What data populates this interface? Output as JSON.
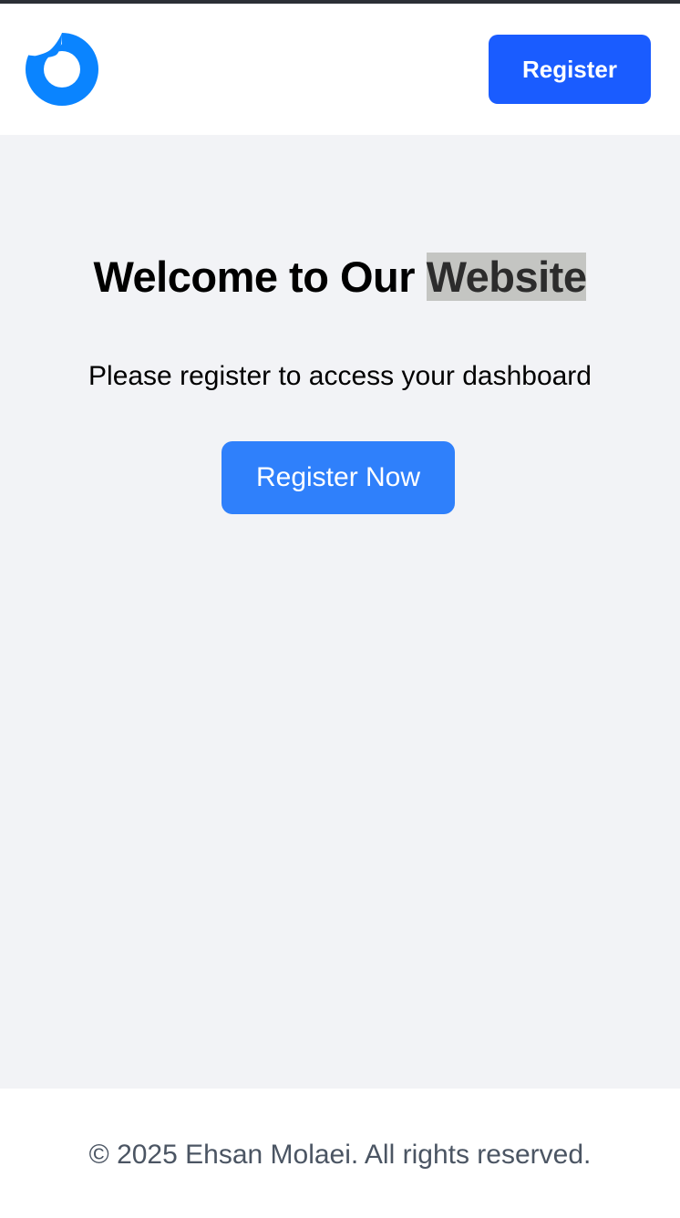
{
  "header": {
    "logo_icon": "circular-logo-icon",
    "register_label": "Register"
  },
  "hero": {
    "title_prefix": "Welcome to Our ",
    "title_highlight": "Website",
    "subtitle": "Please register to access your dashboard",
    "cta_label": "Register Now"
  },
  "footer": {
    "copyright": "© 2025 Ehsan Molaei. All rights reserved."
  },
  "colors": {
    "brand_blue": "#1a5cff",
    "cta_blue": "#2f80fb",
    "logo_blue": "#0a84ff",
    "page_bg": "#f2f3f6",
    "footer_text": "#4b5563",
    "highlight_bg": "#c4c5c2"
  }
}
